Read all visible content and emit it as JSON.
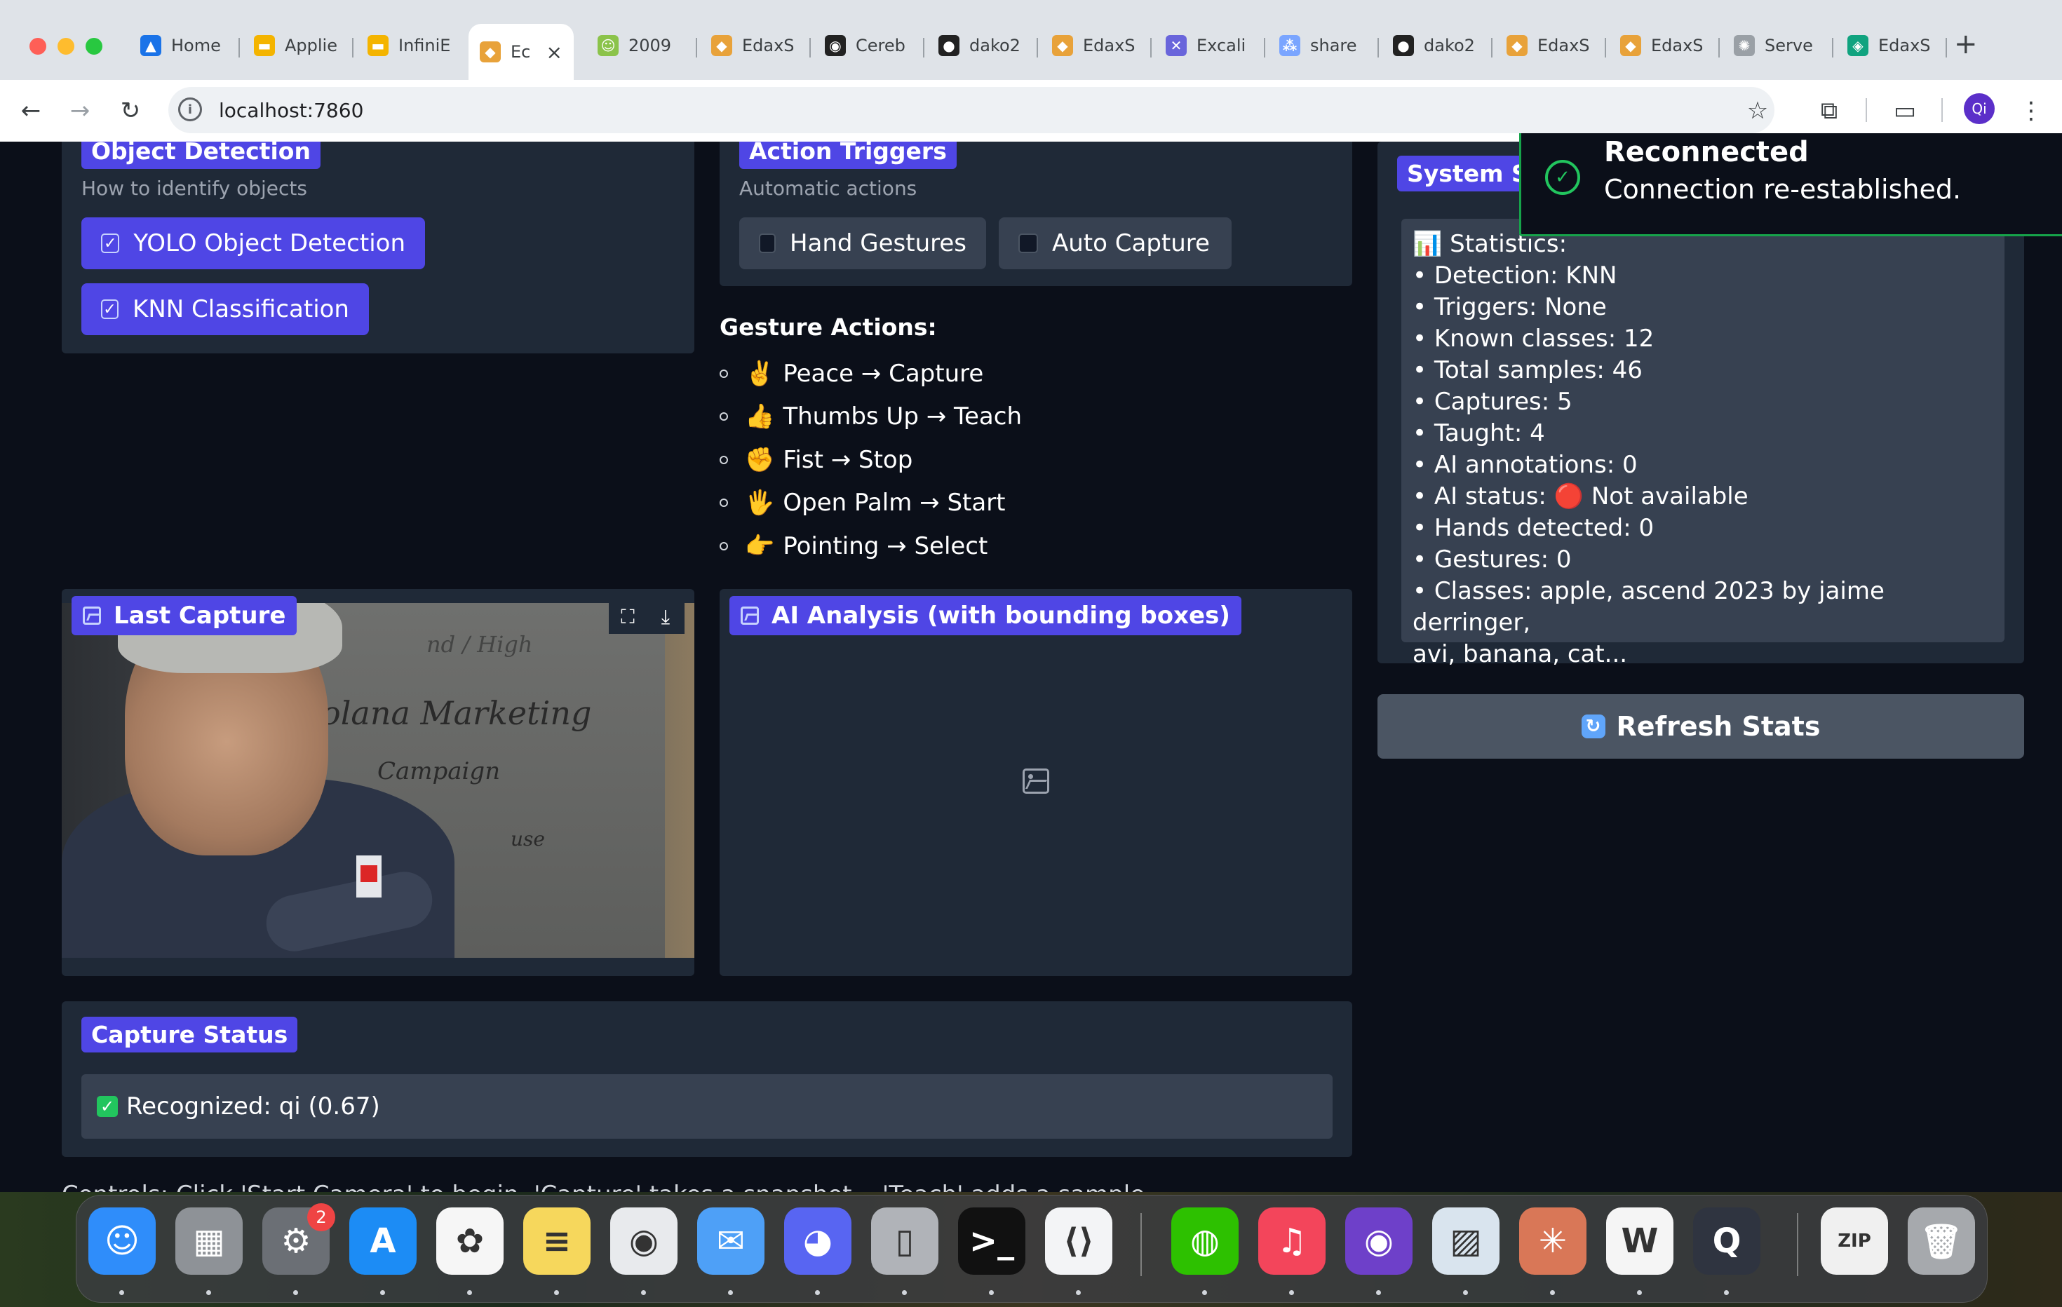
{
  "browser": {
    "tabs": [
      {
        "label": "Home",
        "color": "#1a73e8",
        "glyph": "▲"
      },
      {
        "label": "Applie",
        "color": "#f4b400",
        "glyph": "▬"
      },
      {
        "label": "InfiniE",
        "color": "#f4b400",
        "glyph": "▬"
      },
      {
        "label": "Ec",
        "color": "#e8a23a",
        "glyph": "◆",
        "active": true
      },
      {
        "label": "2009",
        "color": "#8bc34a",
        "glyph": "☺"
      },
      {
        "label": "EdaxS",
        "color": "#e8a23a",
        "glyph": "◆"
      },
      {
        "label": "Cereb",
        "color": "#222222",
        "glyph": "◉"
      },
      {
        "label": "dako2",
        "color": "#222222",
        "glyph": "●"
      },
      {
        "label": "EdaxS",
        "color": "#e8a23a",
        "glyph": "◆"
      },
      {
        "label": "Excali",
        "color": "#6965db",
        "glyph": "✕"
      },
      {
        "label": "share",
        "color": "#7aa5ff",
        "glyph": "⁂"
      },
      {
        "label": "dako2",
        "color": "#222222",
        "glyph": "●"
      },
      {
        "label": "EdaxS",
        "color": "#e8a23a",
        "glyph": "◆"
      },
      {
        "label": "EdaxS",
        "color": "#e8a23a",
        "glyph": "◆"
      },
      {
        "label": "Serve",
        "color": "#9aa0a6",
        "glyph": "✺"
      },
      {
        "label": "EdaxS",
        "color": "#10a37f",
        "glyph": "◈"
      }
    ],
    "url": "localhost:7860",
    "avatar": "Qi"
  },
  "object_detection": {
    "title": "Object Detection",
    "subtitle": "How to identify objects",
    "options": [
      {
        "label": "YOLO Object Detection",
        "checked": true
      },
      {
        "label": "KNN Classification",
        "checked": true
      }
    ]
  },
  "action_triggers": {
    "title": "Action Triggers",
    "subtitle": "Automatic actions",
    "options": [
      {
        "label": "Hand Gestures",
        "checked": false
      },
      {
        "label": "Auto Capture",
        "checked": false
      }
    ]
  },
  "gesture_actions": {
    "title": "Gesture Actions:",
    "items": [
      {
        "emoji": "✌️",
        "text": "Peace → Capture"
      },
      {
        "emoji": "👍",
        "text": "Thumbs Up → Teach"
      },
      {
        "emoji": "✊",
        "text": "Fist → Stop"
      },
      {
        "emoji": "🖐",
        "text": "Open Palm → Start"
      },
      {
        "emoji": "👉",
        "text": "Pointing → Select"
      }
    ]
  },
  "system_stats": {
    "title": "System St",
    "lines": [
      "📊 Statistics:",
      "• Detection: KNN",
      "• Triggers: None",
      "• Known classes: 12",
      "• Total samples: 46",
      "• Captures: 5",
      "• Taught: 4",
      "• AI annotations: 0",
      "• AI status: 🔴 Not available",
      "• Hands detected: 0",
      "• Gestures: 0",
      "• Classes: apple, ascend 2023 by jaime derringer,",
      "avi, banana, cat..."
    ],
    "refresh_label": "Refresh Stats"
  },
  "last_capture": {
    "title": "Last Capture",
    "board_text": [
      "olana Marketing",
      "Campaign",
      "use",
      "nd / High"
    ]
  },
  "ai_analysis": {
    "title": "AI Analysis (with bounding boxes)"
  },
  "capture_status": {
    "title": "Capture Status",
    "text": "Recognized: qi (0.67)"
  },
  "footer": {
    "text": "Controls: Click 'Start Camera' to begin. 'Capture' takes a snapshot... 'Teach' adds a sample..."
  },
  "toast": {
    "title": "Reconnected",
    "message": "Connection re-established."
  },
  "dock": {
    "apps": [
      {
        "name": "finder",
        "color": "#2f8dfa",
        "glyph": "☺"
      },
      {
        "name": "launchpad",
        "color": "#8e9297",
        "glyph": "▦"
      },
      {
        "name": "system-settings",
        "color": "#6b6f75",
        "glyph": "⚙",
        "badge": "2"
      },
      {
        "name": "app-store",
        "color": "#1c8cf5",
        "glyph": "A"
      },
      {
        "name": "photos",
        "color": "#f6f6f6",
        "glyph": "✿"
      },
      {
        "name": "notes",
        "color": "#f6d75c",
        "glyph": "≡"
      },
      {
        "name": "chrome",
        "color": "#e8eaed",
        "glyph": "◉"
      },
      {
        "name": "mail",
        "color": "#4ea0f7",
        "glyph": "✉"
      },
      {
        "name": "discord",
        "color": "#5865f2",
        "glyph": "◕"
      },
      {
        "name": "iphone-mirroring",
        "color": "#b0b3b8",
        "glyph": "▯"
      },
      {
        "name": "terminal",
        "color": "#111111",
        "glyph": ">_"
      },
      {
        "name": "vscode",
        "color": "#f3f4f6",
        "glyph": "⟨⟩"
      },
      {
        "name": "wechat",
        "color": "#2dc100",
        "glyph": "◍"
      },
      {
        "name": "music",
        "color": "#f3455b",
        "glyph": "♫"
      },
      {
        "name": "github-desktop",
        "color": "#6e40c9",
        "glyph": "◉"
      },
      {
        "name": "preview",
        "color": "#d9e4ee",
        "glyph": "▨"
      },
      {
        "name": "claude",
        "color": "#d97757",
        "glyph": "✳"
      },
      {
        "name": "warp",
        "color": "#f5f5f5",
        "glyph": "W"
      },
      {
        "name": "quicktime",
        "color": "#2f3440",
        "glyph": "Q"
      },
      {
        "name": "archive-file",
        "color": "#f0f0f0",
        "glyph": "ZIP"
      },
      {
        "name": "trash",
        "color": "#a6a9ad",
        "glyph": "🗑"
      }
    ]
  }
}
